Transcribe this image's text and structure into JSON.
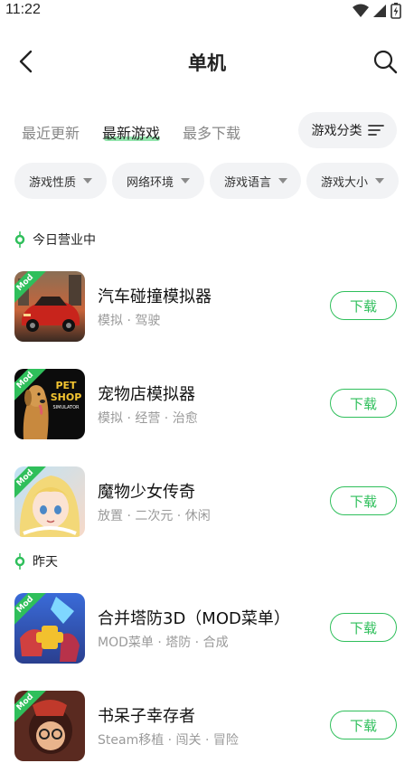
{
  "status": {
    "time": "11:22"
  },
  "header": {
    "title": "单机"
  },
  "tabs": [
    {
      "label": "最近更新"
    },
    {
      "label": "最新游戏"
    },
    {
      "label": "最多下载"
    }
  ],
  "category_button": {
    "label": "游戏分类"
  },
  "filters": [
    {
      "label": "游戏性质"
    },
    {
      "label": "网络环境"
    },
    {
      "label": "游戏语言"
    },
    {
      "label": "游戏大小"
    }
  ],
  "sections": [
    {
      "label": "今日营业中"
    },
    {
      "label": "昨天"
    }
  ],
  "games": [
    {
      "name": "汽车碰撞模拟器",
      "tags": "模拟 · 驾驶",
      "badge": "Mod",
      "download_label": "下载"
    },
    {
      "name": "宠物店模拟器",
      "tags": "模拟 · 经营 · 治愈",
      "badge": "Mod",
      "download_label": "下载",
      "icon_text": "PET SHOP",
      "icon_subtext": "SIMULATOR"
    },
    {
      "name": "魔物少女传奇",
      "tags": "放置 · 二次元 · 休闲",
      "badge": "Mod",
      "download_label": "下载"
    },
    {
      "name": "合并塔防3D（MOD菜单）",
      "tags": "MOD菜单 · 塔防 · 合成",
      "badge": "Mod",
      "download_label": "下载"
    },
    {
      "name": "书呆子幸存者",
      "tags": "Steam移植 · 闯关 · 冒险",
      "badge": "Mod",
      "download_label": "下载"
    }
  ],
  "colors": {
    "accent": "#2fbf5b",
    "chip_bg": "#f2f3f5",
    "muted_text": "#9a9a9a"
  }
}
